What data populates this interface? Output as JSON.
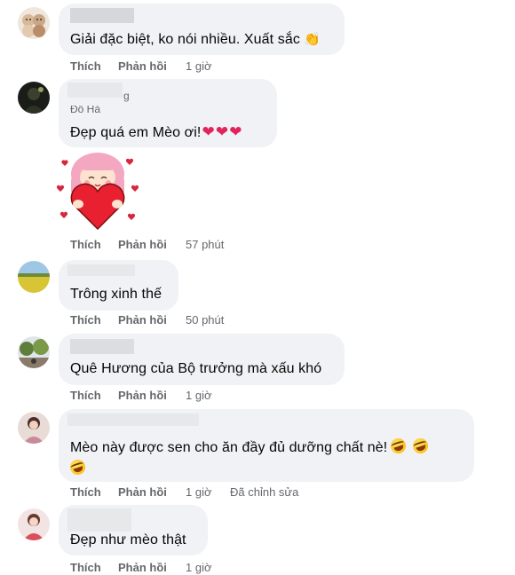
{
  "actions": {
    "like": "Thích",
    "reply": "Phản hồi",
    "edited": "Đã chỉnh sửa"
  },
  "comments": [
    {
      "text": "Giải đặc biệt, ko nói nhiều. Xuất sắc",
      "time": "1 giờ",
      "emoji": "clapping-hands-icon"
    },
    {
      "name_fragment_1": "g",
      "name_fragment_2": "Đỗ Hà",
      "text": "Đẹp quá em Mèo ơi!",
      "time": "57 phút",
      "emoji": "red-heart-icon",
      "sticker": "girl-hugging-heart-sticker"
    },
    {
      "text": "Trông xinh thế",
      "time": "50 phút"
    },
    {
      "text": "Quê Hương của Bộ trưởng mà xấu khó",
      "time": "1 giờ"
    },
    {
      "text_line_1": "Mèo này được sen cho ăn đầy đủ dưỡng chất nè!",
      "time": "1 giờ",
      "edited": true,
      "emoji": "rolling-laughing-icon"
    },
    {
      "text": "Đẹp như mèo thật",
      "time": "1 giờ"
    }
  ],
  "colors": {
    "bubble": "#f0f2f5",
    "text": "#050505",
    "meta": "#65676b",
    "heart": "#e0245e"
  }
}
